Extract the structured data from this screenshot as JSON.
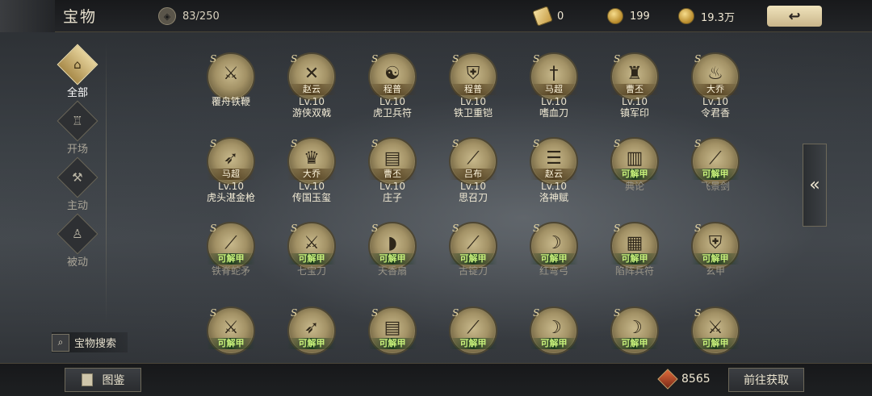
{
  "header": {
    "title": "宝物",
    "capacity_text": "83/250",
    "currencies": [
      {
        "value": "0",
        "icon": "ticket-icon"
      },
      {
        "value": "199",
        "icon": "gold-ingot-icon"
      },
      {
        "value": "19.3万",
        "icon": "coin-icon"
      }
    ],
    "back_icon": "back-arrow-icon"
  },
  "sidebar": {
    "categories": [
      {
        "label": "全部",
        "icon": "all-treasure-icon",
        "active": true
      },
      {
        "label": "开场",
        "icon": "opening-icon",
        "active": false
      },
      {
        "label": "主动",
        "icon": "active-skill-icon",
        "active": false
      },
      {
        "label": "被动",
        "icon": "passive-skill-icon",
        "active": false
      }
    ],
    "search_label": "宝物搜索"
  },
  "items": [
    {
      "owner": "",
      "level": "",
      "name": "覆舟铁鞭",
      "glyph": "⚔"
    },
    {
      "owner": "赵云",
      "level": "Lv.10",
      "name": "游侠双戟",
      "glyph": "✕"
    },
    {
      "owner": "程普",
      "level": "Lv.10",
      "name": "虎卫兵符",
      "glyph": "☯"
    },
    {
      "owner": "程普",
      "level": "Lv.10",
      "name": "铁卫重铠",
      "glyph": "⛨"
    },
    {
      "owner": "马超",
      "level": "Lv.10",
      "name": "嗜血刀",
      "glyph": "†"
    },
    {
      "owner": "曹丕",
      "level": "Lv.10",
      "name": "镇军印",
      "glyph": "♜"
    },
    {
      "owner": "大乔",
      "level": "Lv.10",
      "name": "令君香",
      "glyph": "♨"
    },
    {
      "owner": "马超",
      "level": "Lv.10",
      "name": "虎头湛金枪",
      "glyph": "➶"
    },
    {
      "owner": "大乔",
      "level": "Lv.10",
      "name": "传国玉玺",
      "glyph": "♛"
    },
    {
      "owner": "曹丕",
      "level": "Lv.10",
      "name": "庄子",
      "glyph": "▤"
    },
    {
      "owner": "吕布",
      "level": "Lv.10",
      "name": "思召刀",
      "glyph": "⟋"
    },
    {
      "owner": "赵云",
      "level": "Lv.10",
      "name": "洛神赋",
      "glyph": "☰"
    },
    {
      "owner": "可解甲",
      "level": "",
      "name": "典论",
      "glyph": "▥"
    },
    {
      "owner": "可解甲",
      "level": "",
      "name": "飞景剑",
      "glyph": "⟋"
    },
    {
      "owner": "可解甲",
      "level": "",
      "name": "铁脊蛇矛",
      "glyph": "⟋"
    },
    {
      "owner": "可解甲",
      "level": "",
      "name": "七宝刀",
      "glyph": "⚔"
    },
    {
      "owner": "可解甲",
      "level": "",
      "name": "天香扇",
      "glyph": "◗"
    },
    {
      "owner": "可解甲",
      "level": "",
      "name": "古锭刀",
      "glyph": "⟋"
    },
    {
      "owner": "可解甲",
      "level": "",
      "name": "红弯弓",
      "glyph": "☽"
    },
    {
      "owner": "可解甲",
      "level": "",
      "name": "陷阵兵符",
      "glyph": "▦"
    },
    {
      "owner": "可解甲",
      "level": "",
      "name": "玄甲",
      "glyph": "⛨"
    },
    {
      "owner": "可解甲",
      "level": "",
      "name": "",
      "glyph": "⚔"
    },
    {
      "owner": "可解甲",
      "level": "",
      "name": "",
      "glyph": "➶"
    },
    {
      "owner": "可解甲",
      "level": "",
      "name": "",
      "glyph": "▤"
    },
    {
      "owner": "可解甲",
      "level": "",
      "name": "",
      "glyph": "⟋"
    },
    {
      "owner": "可解甲",
      "level": "",
      "name": "",
      "glyph": "☽"
    },
    {
      "owner": "可解甲",
      "level": "",
      "name": "",
      "glyph": "☽"
    },
    {
      "owner": "可解甲",
      "level": "",
      "name": "",
      "glyph": "⚔"
    }
  ],
  "side_toggle_icon": "double-chevron-left-icon",
  "side_toggle_glyph": "«",
  "footer": {
    "codex_label": "图鉴",
    "cost_value": "8565",
    "go_label": "前往获取"
  }
}
